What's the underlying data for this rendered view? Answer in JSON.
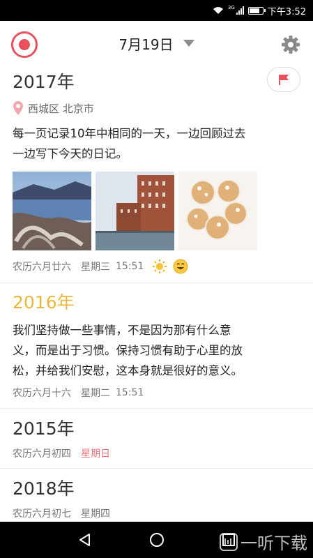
{
  "status": {
    "time": "下午3:52",
    "network": "3G"
  },
  "header": {
    "date": "7月19日"
  },
  "entries": [
    {
      "year": "2017年",
      "location": "西城区 北京市",
      "text_line1": "每一页记录10年中相同的一天，一边回顾过去",
      "text_line2": "一边写下今天的日记。",
      "lunar": "农历六月廿六",
      "weekday": "星期三",
      "time": "15:51"
    },
    {
      "year": "2016年",
      "text_line1": "我们坚持做一些事情，不是因为那有什么意",
      "text_line2": "义，而是出于习惯。保持习惯有助于心里的放",
      "text_line3": "松，并给我们安慰，这本身就是很好的意义。",
      "lunar": "农历六月十六",
      "weekday": "星期二",
      "time": "15:51"
    },
    {
      "year": "2015年",
      "lunar": "农历六月初四",
      "weekday": "星期日"
    },
    {
      "year": "2018年",
      "lunar": "农历六月初七",
      "weekday": "星期四"
    }
  ],
  "watermark": "一听下载",
  "colors": {
    "accent": "#e8505b",
    "gold_year": "#e7b83a",
    "sunday": "#e8737a"
  }
}
